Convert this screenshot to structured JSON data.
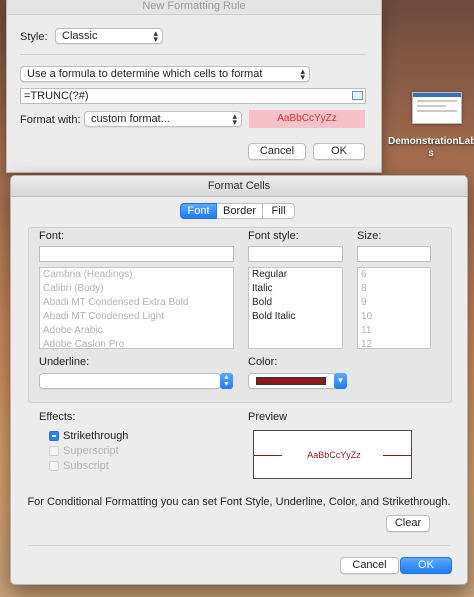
{
  "new_rule_dialog": {
    "title": "New Formatting Rule",
    "style_label": "Style:",
    "style_value": "Classic",
    "rule_type_value": "Use a formula to determine which cells to format",
    "formula_value": "=TRUNC(?#)",
    "format_with_label": "Format with:",
    "format_with_value": "custom format...",
    "sample_text": "AaBbCcYyZz",
    "sample_bg": "#f6c1c8",
    "cancel_label": "Cancel",
    "ok_label": "OK"
  },
  "desktop": {
    "icon_label": "DemonstrationLab",
    "icon_label_line2": "s"
  },
  "format_cells": {
    "title": "Format Cells",
    "tabs": [
      {
        "label": "Font"
      },
      {
        "label": "Border"
      },
      {
        "label": "Fill"
      }
    ],
    "font_label": "Font:",
    "font_style_label": "Font style:",
    "size_label": "Size:",
    "font_items": [
      "Cambria (Headings)",
      "Calibri (Body)",
      "Abadi MT Condensed Extra Bold",
      "Abadi MT Condensed Light",
      "Adobe Arabic",
      "Adobe Caslon Pro"
    ],
    "font_style_items": [
      "Regular",
      "Italic",
      "Bold",
      "Bold Italic"
    ],
    "size_items": [
      "6",
      "8",
      "9",
      "10",
      "11",
      "12"
    ],
    "underline_label": "Underline:",
    "color_label": "Color:",
    "color_value": "#8b1a1a",
    "effects_label": "Effects:",
    "effects": [
      {
        "label": "Strikethrough",
        "checked": true
      },
      {
        "label": "Superscript",
        "checked": false
      },
      {
        "label": "Subscript",
        "checked": false
      }
    ],
    "preview_label": "Preview",
    "preview_text": "AaBbCcYyZz",
    "info_text": "For Conditional Formatting you can set Font Style, Underline, Color, and Strikethrough.",
    "clear_label": "Clear",
    "cancel_label": "Cancel",
    "ok_label": "OK"
  }
}
